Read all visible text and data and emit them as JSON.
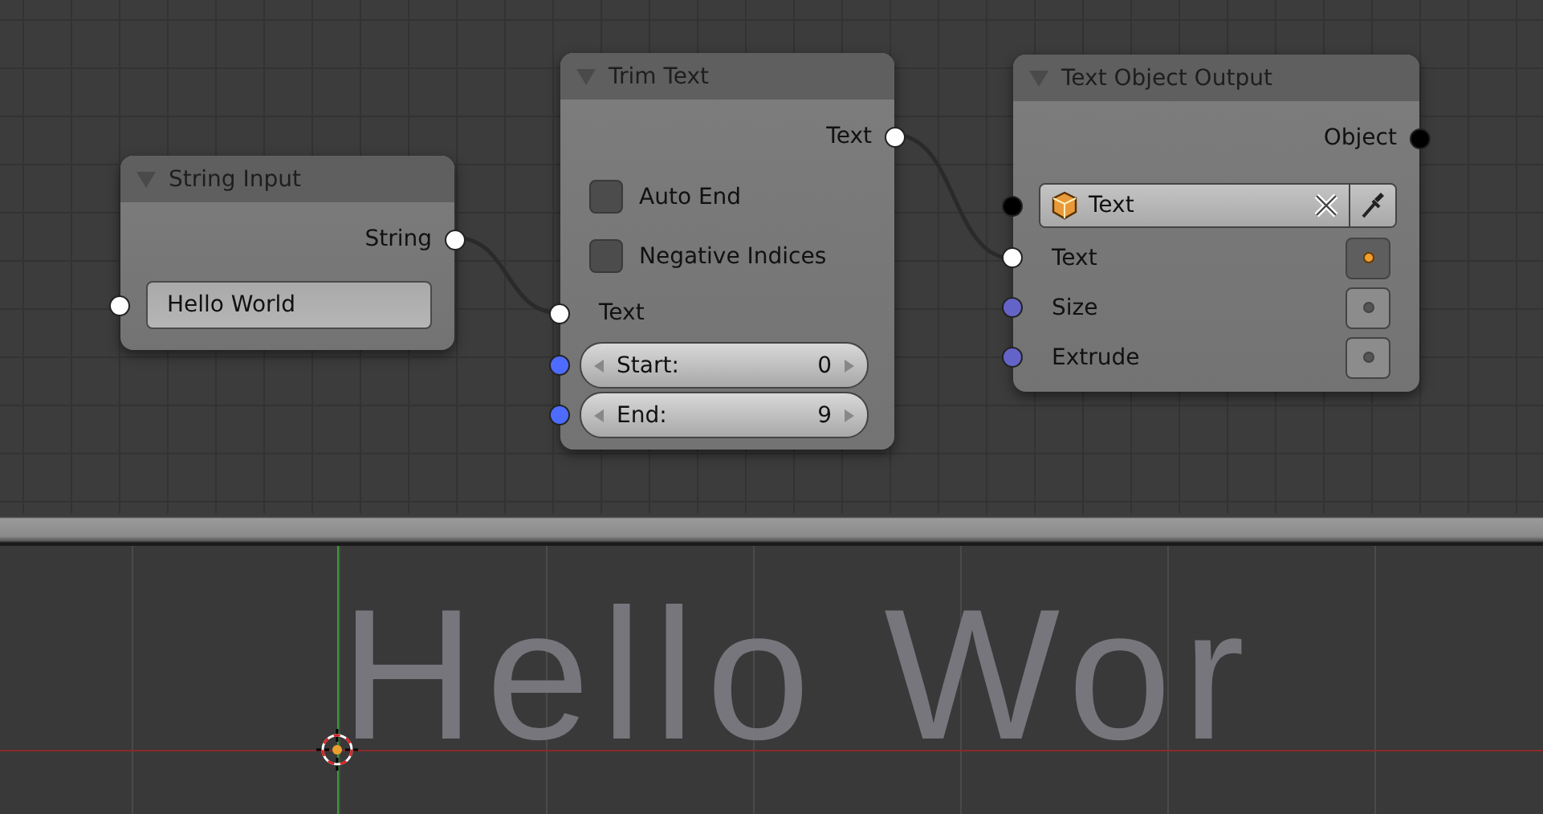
{
  "node_editor": {
    "nodes": [
      {
        "title": "String Input",
        "expanded": true,
        "rows": [
          {
            "kind": "output",
            "label": "String",
            "color": "#ffffff"
          },
          {
            "kind": "text_field",
            "value": "Hello World",
            "color": "#ffffff"
          }
        ]
      },
      {
        "title": "Trim Text",
        "expanded": true,
        "rows": [
          {
            "kind": "output",
            "label": "Text",
            "color": "#ffffff"
          },
          {
            "kind": "checkbox",
            "label": "Auto End",
            "checked": false
          },
          {
            "kind": "checkbox",
            "label": "Negative Indices",
            "checked": false
          },
          {
            "kind": "input",
            "label": "Text",
            "color": "#ffffff"
          },
          {
            "kind": "number_field",
            "label": "Start:",
            "value": "0",
            "color": "#4d6cff"
          },
          {
            "kind": "number_field",
            "label": "End:",
            "value": "9",
            "color": "#4d6cff"
          }
        ]
      },
      {
        "title": "Text Object Output",
        "expanded": true,
        "rows": [
          {
            "kind": "output",
            "label": "Object",
            "color": "#000000"
          },
          {
            "kind": "object_field",
            "value": "Text",
            "color": "#000000"
          },
          {
            "kind": "toggle_input",
            "label": "Text",
            "color": "#ffffff",
            "selected": true
          },
          {
            "kind": "toggle_input",
            "label": "Size",
            "color": "#6464c8",
            "selected": false
          },
          {
            "kind": "toggle_input",
            "label": "Extrude",
            "color": "#6464c8",
            "selected": false
          }
        ]
      }
    ]
  },
  "viewport": {
    "text": "Hello Wor"
  }
}
